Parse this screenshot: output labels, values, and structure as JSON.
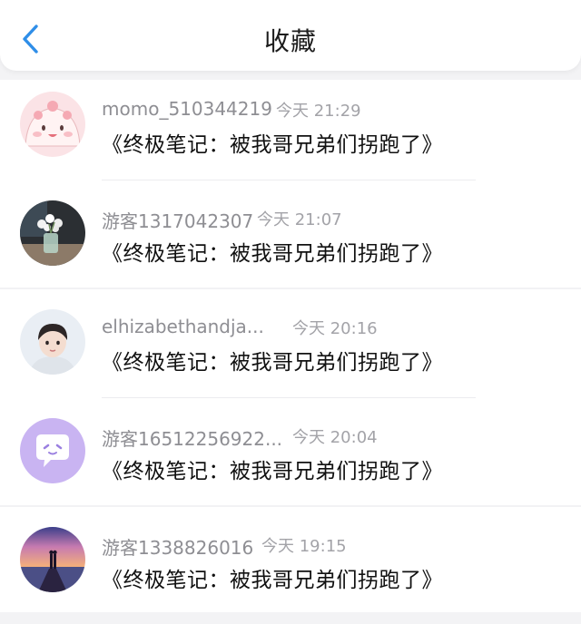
{
  "header": {
    "title": "收藏",
    "back_icon": "chevron-left-icon",
    "accent": "#2f8ee8"
  },
  "items": [
    {
      "username": "momo_510344219",
      "time": "今天 21:29",
      "message": "《终极笔记：被我哥兄弟们拐跑了》",
      "avatar": "pink-cartoon-avatar"
    },
    {
      "username": "游客1317042307",
      "time": "今天 21:07",
      "message": "《终极笔记：被我哥兄弟们拐跑了》",
      "avatar": "flower-vase-avatar"
    },
    {
      "username": "elhizabethandja...",
      "time": "今天 20:16",
      "message": "《终极笔记：被我哥兄弟们拐跑了》",
      "avatar": "person-photo-avatar"
    },
    {
      "username": "游客16512256922...",
      "time": "今天 20:04",
      "message": "《终极笔记：被我哥兄弟们拐跑了》",
      "avatar": "purple-chat-bubble-avatar"
    },
    {
      "username": "游客1338826016",
      "time": "今天 19:15",
      "message": "《终极笔记：被我哥兄弟们拐跑了》",
      "avatar": "sunset-pier-avatar"
    }
  ]
}
